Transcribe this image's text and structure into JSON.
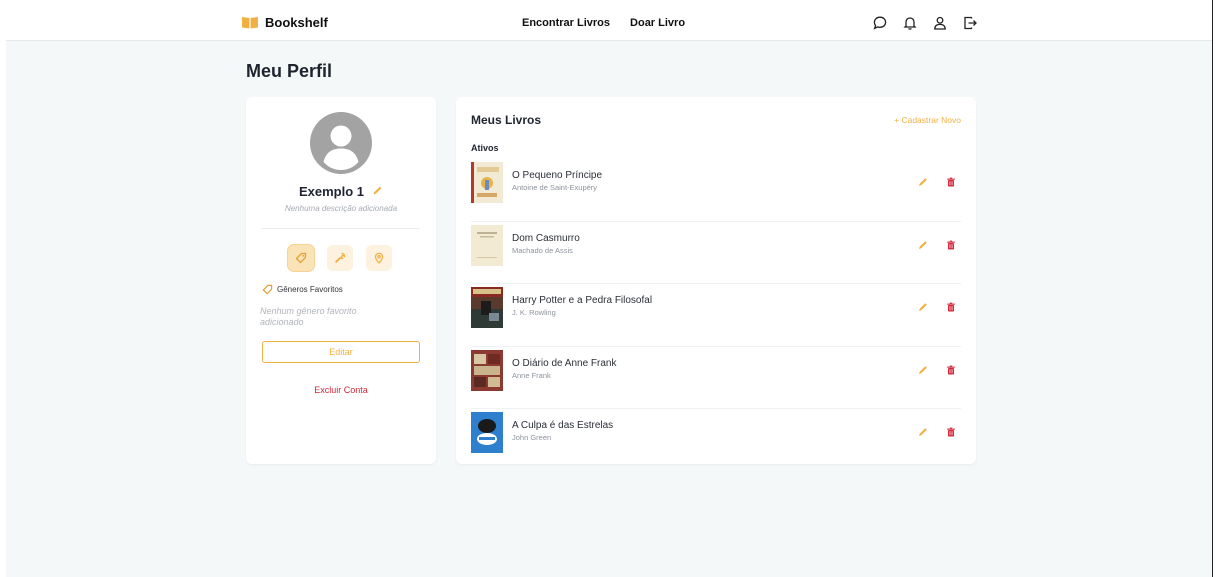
{
  "brand": {
    "name": "Bookshelf",
    "accent": "#F2B042"
  },
  "nav": {
    "find_books": "Encontrar Livros",
    "donate_book": "Doar Livro"
  },
  "header_icons": [
    "chat-icon",
    "bell-icon",
    "user-icon",
    "logout-icon"
  ],
  "page": {
    "title": "Meu Perfil"
  },
  "profile": {
    "name": "Exemplo 1",
    "description": "Nenhuma descrição adicionada",
    "tabs": [
      "tag-icon",
      "wrench-icon",
      "location-pin-icon"
    ],
    "favorites_label": "Gêneros Favoritos",
    "favorites_empty": "Nenhum gênero favorito adicionado",
    "edit_label": "Editar",
    "delete_account_label": "Excluir Conta"
  },
  "books": {
    "title": "Meus Livros",
    "add_new_label": "+ Cadastrar Novo",
    "section_label": "Ativos",
    "items": [
      {
        "title": "O Pequeno Príncipe",
        "author": "Antoine de Saint-Exupéry"
      },
      {
        "title": "Dom Casmurro",
        "author": "Machado de Assis"
      },
      {
        "title": "Harry Potter e a Pedra Filosofal",
        "author": "J. K. Rowling"
      },
      {
        "title": "O Diário de Anne Frank",
        "author": "Anne Frank"
      },
      {
        "title": "A Culpa é das Estrelas",
        "author": "John Green"
      }
    ]
  },
  "colors": {
    "accent": "#F2B042",
    "danger": "#D2283A",
    "background": "#F4F8F9"
  }
}
